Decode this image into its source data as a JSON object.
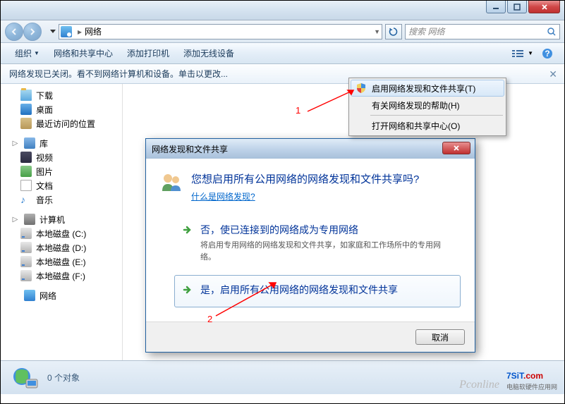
{
  "window": {
    "title": "网络"
  },
  "nav": {
    "breadcrumb": "网络",
    "search_placeholder": "搜索 网络"
  },
  "toolbar": {
    "organize": "组织",
    "network_center": "网络和共享中心",
    "add_printer": "添加打印机",
    "add_wireless": "添加无线设备"
  },
  "infobar": {
    "text": "网络发现已关闭。看不到网络计算机和设备。单击以更改..."
  },
  "sidebar": {
    "downloads": "下载",
    "desktop": "桌面",
    "recent": "最近访问的位置",
    "library": "库",
    "videos": "视频",
    "pictures": "图片",
    "documents": "文档",
    "music": "音乐",
    "computer": "计算机",
    "drive_c": "本地磁盘 (C:)",
    "drive_d": "本地磁盘 (D:)",
    "drive_e": "本地磁盘 (E:)",
    "drive_f": "本地磁盘 (F:)",
    "network": "网络"
  },
  "context_menu": {
    "enable": "启用网络发现和文件共享(T)",
    "help": "有关网络发现的帮助(H)",
    "open_center": "打开网络和共享中心(O)"
  },
  "dialog": {
    "title": "网络发现和文件共享",
    "question": "您想启用所有公用网络的网络发现和文件共享吗?",
    "link": "什么是网络发现?",
    "opt1_title": "否，使已连接到的网络成为专用网络",
    "opt1_desc": "将启用专用网络的网络发现和文件共享，如家庭和工作场所中的专用网络。",
    "opt2_title": "是，启用所有公用网络的网络发现和文件共享",
    "cancel": "取消"
  },
  "status": {
    "text": "0 个对象"
  },
  "annotations": {
    "num1": "1",
    "num2": "2"
  },
  "watermark": {
    "pconline": "Pconline",
    "site_blue": "7SiT",
    "site_red": ".com",
    "sub": "电脑软硬件应用网"
  }
}
